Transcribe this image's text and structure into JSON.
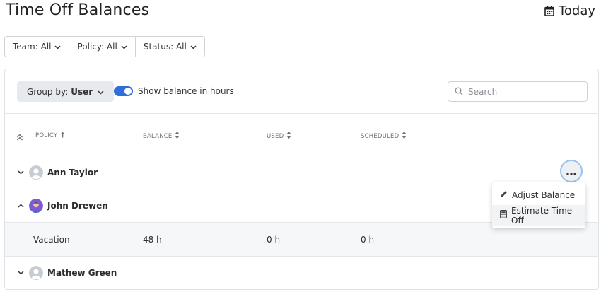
{
  "header": {
    "title": "Time Off Balances",
    "today_label": "Today"
  },
  "filters": [
    {
      "label": "Team: All"
    },
    {
      "label": "Policy: All"
    },
    {
      "label": "Status: All"
    }
  ],
  "toolbar": {
    "group_by_prefix": "Group by:",
    "group_by_value": "User",
    "toggle_label": "Show balance in hours",
    "toggle_on": true,
    "search_placeholder": "Search"
  },
  "table": {
    "columns": [
      "POLICY",
      "BALANCE",
      "USED",
      "SCHEDULED"
    ],
    "users": [
      {
        "name": "Ann Taylor",
        "expanded": false
      },
      {
        "name": "John Drewen",
        "expanded": true,
        "policies": [
          {
            "policy": "Vacation",
            "balance": "48 h",
            "used": "0 h",
            "scheduled": "0 h"
          }
        ]
      },
      {
        "name": "Mathew Green",
        "expanded": false
      }
    ]
  },
  "context_menu": {
    "items": [
      {
        "label": "Adjust Balance",
        "icon": "pencil-icon"
      },
      {
        "label": "Estimate Time Off",
        "icon": "calculator-icon"
      }
    ]
  },
  "colors": {
    "accent": "#2f6fdc",
    "focus_ring": "#9cc1ef"
  }
}
